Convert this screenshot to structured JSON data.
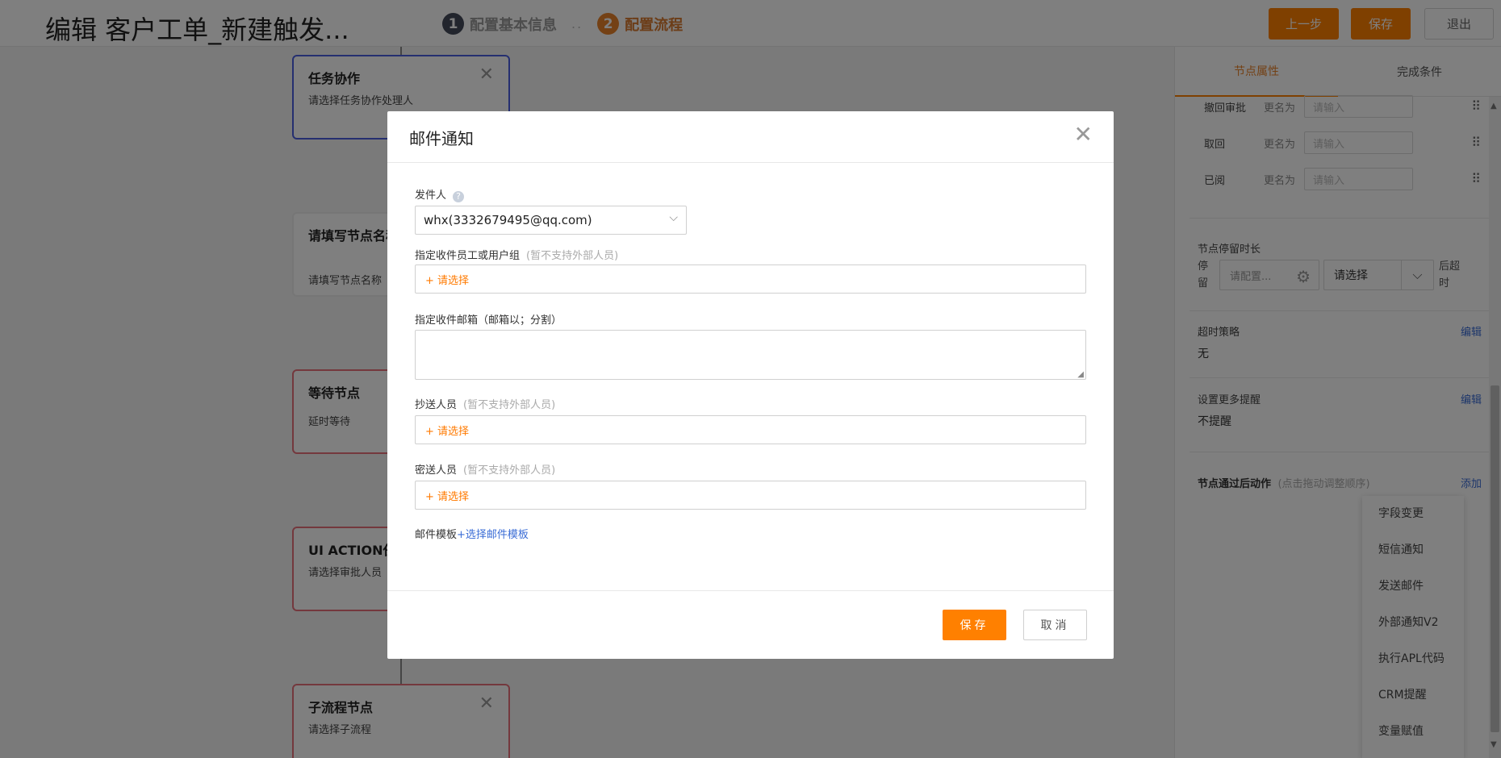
{
  "header": {
    "title": "编辑 客户工单_新建触发...",
    "steps": [
      {
        "num": "1",
        "label": "配置基本信息"
      },
      {
        "num": "2",
        "label": "配置流程"
      }
    ],
    "step_separator": "..",
    "prev_label": "上一步",
    "save_label": "保存",
    "exit_label": "退出"
  },
  "nodes": [
    {
      "title": "任务协作",
      "desc": "请选择任务协作处理人"
    },
    {
      "title": "请填写节点名称",
      "desc": "请填写节点名称"
    },
    {
      "title": "等待节点",
      "desc": "延时等待"
    },
    {
      "title": "UI ACTION任务",
      "desc": "请选择审批人员"
    },
    {
      "title": "子流程节点",
      "desc": "请选择子流程"
    }
  ],
  "node_close": "✕",
  "right_panel": {
    "tabs": [
      "节点属性",
      "完成条件"
    ],
    "buttons": [
      {
        "label": "撤回审批",
        "rename": "更名为",
        "placeholder": "请输入"
      },
      {
        "label": "取回",
        "rename": "更名为",
        "placeholder": "请输入"
      },
      {
        "label": "已阅",
        "rename": "更名为",
        "placeholder": "请输入"
      }
    ],
    "drag_glyph": "⠿",
    "stay": {
      "title": "节点停留时长",
      "stay_label": "停留",
      "config_placeholder": "请配置...",
      "select_value": "请选择",
      "timeout_label": "后超时"
    },
    "timeout_policy": {
      "label": "超时策略",
      "edit": "编辑",
      "value": "无"
    },
    "reminder": {
      "label": "设置更多提醒",
      "edit": "编辑",
      "value": "不提醒"
    },
    "after_action": {
      "label": "节点通过后动作",
      "hint": "(点击拖动调整顺序)",
      "add": "添加"
    },
    "action_menu": [
      "字段变更",
      "短信通知",
      "发送邮件",
      "外部通知V2",
      "执行APL代码",
      "CRM提醒",
      "变量赋值"
    ]
  },
  "modal": {
    "title": "邮件通知",
    "close": "✕",
    "sender_label": "发件人",
    "help": "?",
    "sender_value": "whx(3332679495@qq.com)",
    "recipients_label": "指定收件员工或用户组",
    "recipients_hint": "(暂不支持外部人员)",
    "recipients_placeholder": "+ 请选择",
    "emails_label": "指定收件邮箱（邮箱以；分割）",
    "cc_label": "抄送人员",
    "cc_hint": "(暂不支持外部人员)",
    "cc_placeholder": "+ 请选择",
    "bcc_label": "密送人员",
    "bcc_hint": "(暂不支持外部人员)",
    "bcc_placeholder": "+ 请选择",
    "template_label": "邮件模板",
    "template_link": "+选择邮件模板",
    "save_label": "保存",
    "cancel_label": "取消"
  }
}
